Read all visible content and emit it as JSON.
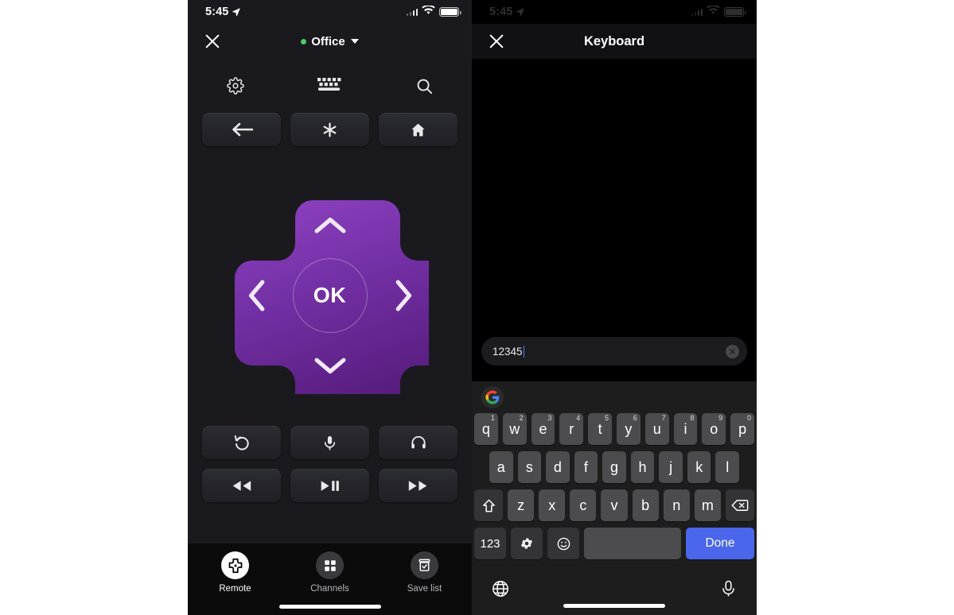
{
  "left_phone": {
    "status_bar": {
      "time": "5:45",
      "location_icon": "location-arrow-icon",
      "wifi_icon": "wifi-icon",
      "battery_icon": "battery-full-icon"
    },
    "header": {
      "close_label": "✕",
      "device_name": "Office",
      "device_status": "online",
      "dropdown_icon": "chevron-down-icon"
    },
    "icon_row": [
      {
        "name": "settings",
        "icon": "gear-icon"
      },
      {
        "name": "keyboard",
        "icon": "keyboard-icon"
      },
      {
        "name": "search",
        "icon": "search-icon"
      }
    ],
    "nav_buttons": [
      {
        "name": "back",
        "icon": "arrow-left-icon"
      },
      {
        "name": "options",
        "icon": "asterisk-icon"
      },
      {
        "name": "home",
        "icon": "home-icon"
      }
    ],
    "dpad": {
      "ok_label": "OK",
      "up_icon": "chevron-up-icon",
      "down_icon": "chevron-down-icon",
      "left_icon": "chevron-left-icon",
      "right_icon": "chevron-right-icon",
      "color_top": "#8c3dbb",
      "color_bottom": "#5a1f80"
    },
    "media_buttons": [
      {
        "name": "replay",
        "icon": "replay-icon"
      },
      {
        "name": "voice",
        "icon": "microphone-icon"
      },
      {
        "name": "private-listening",
        "icon": "headphones-icon"
      },
      {
        "name": "rewind",
        "icon": "rewind-icon"
      },
      {
        "name": "play-pause",
        "icon": "play-pause-icon"
      },
      {
        "name": "fast-forward",
        "icon": "fast-forward-icon"
      }
    ],
    "tabs": [
      {
        "label": "Remote",
        "icon": "dpad-icon",
        "active": true
      },
      {
        "label": "Channels",
        "icon": "grid-icon",
        "active": false
      },
      {
        "label": "Save list",
        "icon": "save-list-icon",
        "active": false
      }
    ]
  },
  "right_phone": {
    "status_bar": {
      "time": "5:45",
      "location_icon": "location-arrow-icon",
      "wifi_icon": "wifi-icon",
      "battery_icon": "battery-full-icon"
    },
    "header": {
      "close_label": "✕",
      "title": "Keyboard"
    },
    "input": {
      "value": "12345",
      "placeholder": "",
      "clear_icon": "clear-circle-icon"
    },
    "keyboard": {
      "suggestion_icon": "google-logo-icon",
      "row1": [
        {
          "key": "q",
          "hint": "1"
        },
        {
          "key": "w",
          "hint": "2"
        },
        {
          "key": "e",
          "hint": "3"
        },
        {
          "key": "r",
          "hint": "4"
        },
        {
          "key": "t",
          "hint": "5"
        },
        {
          "key": "y",
          "hint": "6"
        },
        {
          "key": "u",
          "hint": "7"
        },
        {
          "key": "i",
          "hint": "8"
        },
        {
          "key": "o",
          "hint": "9"
        },
        {
          "key": "p",
          "hint": "0"
        }
      ],
      "row2": [
        "a",
        "s",
        "d",
        "f",
        "g",
        "h",
        "j",
        "k",
        "l"
      ],
      "row3_shift_icon": "shift-icon",
      "row3": [
        "z",
        "x",
        "c",
        "v",
        "b",
        "n",
        "m"
      ],
      "row3_backspace_icon": "backspace-icon",
      "numeric_label": "123",
      "settings_icon": "gear-icon",
      "emoji_icon": "emoji-smile-icon",
      "space_label": "",
      "done_label": "Done",
      "globe_icon": "globe-icon",
      "mic_icon": "microphone-icon",
      "done_color": "#4a66ea"
    }
  }
}
